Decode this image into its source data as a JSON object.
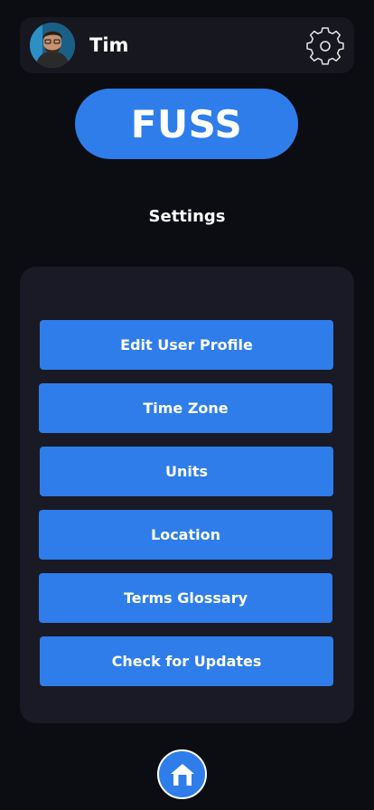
{
  "header": {
    "user_name": "Tim",
    "avatar_icon": "user-avatar",
    "settings_icon": "gear-icon"
  },
  "logo": {
    "text": "FUSS"
  },
  "page": {
    "title": "Settings"
  },
  "menu": {
    "items": [
      {
        "label": "Edit User Profile"
      },
      {
        "label": "Time Zone"
      },
      {
        "label": "Units"
      },
      {
        "label": "Location"
      },
      {
        "label": "Terms Glossary"
      },
      {
        "label": "Check for Updates"
      }
    ]
  },
  "nav": {
    "home_icon": "home-icon"
  },
  "colors": {
    "background": "#0c0d13",
    "panel": "#1a1a26",
    "accent": "#2f7dea",
    "text": "#ffffff"
  }
}
